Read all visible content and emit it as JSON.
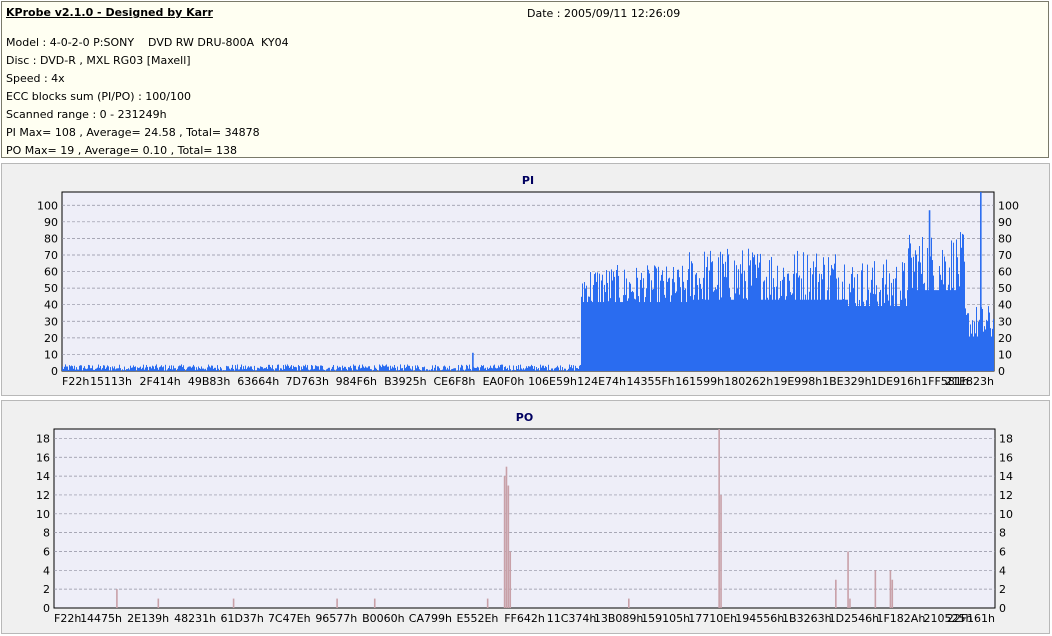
{
  "info": {
    "title": "KProbe v2.1.0 - Designed by Karr",
    "date": "Date : 2005/09/11 12:26:09",
    "lines": [
      "Model : 4-0-2-0 P:SONY    DVD RW DRU-800A  KY04",
      "Disc : DVD-R , MXL RG03 [Maxell]",
      "Speed : 4x",
      "ECC blocks sum (PI/PO) : 100/100",
      "Scanned range : 0 - 231249h",
      "PI Max= 108 , Average= 24.58 , Total= 34878",
      "PO Max= 19 , Average= 0.10 , Total= 138"
    ]
  },
  "colors": {
    "pi": "#2a6cf0",
    "po": "#c8a0a8",
    "plot_bg": "#eeeef8",
    "grid": "#9090a0"
  },
  "chart_data": [
    {
      "type": "bar",
      "title": "PI",
      "ylim": [
        0,
        108
      ],
      "yticks": [
        0,
        10,
        20,
        30,
        40,
        50,
        60,
        70,
        80,
        90,
        100
      ],
      "xticks": [
        "F22h",
        "15113h",
        "2F414h",
        "49B83h",
        "63664h",
        "7D763h",
        "984F6h",
        "B3925h",
        "CE6F8h",
        "EA0F0h",
        "106E59h",
        "124E74h",
        "14355Fh",
        "161599h",
        "180262h",
        "19E998h",
        "1BE329h",
        "1DE916h",
        "1FF581h",
        "21E823h"
      ],
      "x_range": [
        0,
        231249
      ],
      "segments": [
        {
          "x": [
            0,
            1240000
          ],
          "base": 2,
          "noise": 2
        },
        {
          "x": [
            1240000,
            1500000
          ],
          "base": 50,
          "noise": 14
        },
        {
          "x": [
            1500000,
            1880000
          ],
          "base": 55,
          "noise": 20
        },
        {
          "x": [
            1880000,
            2020000
          ],
          "base": 50,
          "noise": 18
        },
        {
          "x": [
            2020000,
            2160000
          ],
          "base": 62,
          "noise": 22
        },
        {
          "x": [
            2160000,
            2230000
          ],
          "base": 28,
          "noise": 12
        }
      ],
      "spikes": [
        {
          "x": 0.44,
          "value": 11
        },
        {
          "x": 0.74,
          "value": 22
        },
        {
          "x": 0.93,
          "value": 97
        },
        {
          "x": 0.985,
          "value": 108
        }
      ]
    },
    {
      "type": "bar",
      "title": "PO",
      "ylim": [
        0,
        19
      ],
      "yticks": [
        0,
        2,
        4,
        6,
        8,
        10,
        12,
        14,
        16,
        18
      ],
      "xticks": [
        "F22h",
        "14475h",
        "2E139h",
        "48231h",
        "61D37h",
        "7C47Eh",
        "96577h",
        "B0060h",
        "CA799h",
        "E552Eh",
        "FF642h",
        "11C374h",
        "13B089h",
        "159105h",
        "17710Eh",
        "194556h",
        "1B3263h",
        "1D2546h",
        "1F182Ah",
        "210525h",
        "22F161h"
      ],
      "x_range": [
        0,
        231249
      ],
      "spikes": [
        {
          "x": 0.066,
          "value": 2
        },
        {
          "x": 0.11,
          "value": 1
        },
        {
          "x": 0.19,
          "value": 1
        },
        {
          "x": 0.3,
          "value": 1
        },
        {
          "x": 0.34,
          "value": 1
        },
        {
          "x": 0.46,
          "value": 1
        },
        {
          "x": 0.478,
          "value": 14
        },
        {
          "x": 0.48,
          "value": 15
        },
        {
          "x": 0.482,
          "value": 13
        },
        {
          "x": 0.484,
          "value": 6
        },
        {
          "x": 0.61,
          "value": 1
        },
        {
          "x": 0.706,
          "value": 19
        },
        {
          "x": 0.708,
          "value": 12
        },
        {
          "x": 0.83,
          "value": 3
        },
        {
          "x": 0.843,
          "value": 6
        },
        {
          "x": 0.845,
          "value": 1
        },
        {
          "x": 0.872,
          "value": 4
        },
        {
          "x": 0.888,
          "value": 4
        },
        {
          "x": 0.89,
          "value": 3
        }
      ]
    }
  ]
}
